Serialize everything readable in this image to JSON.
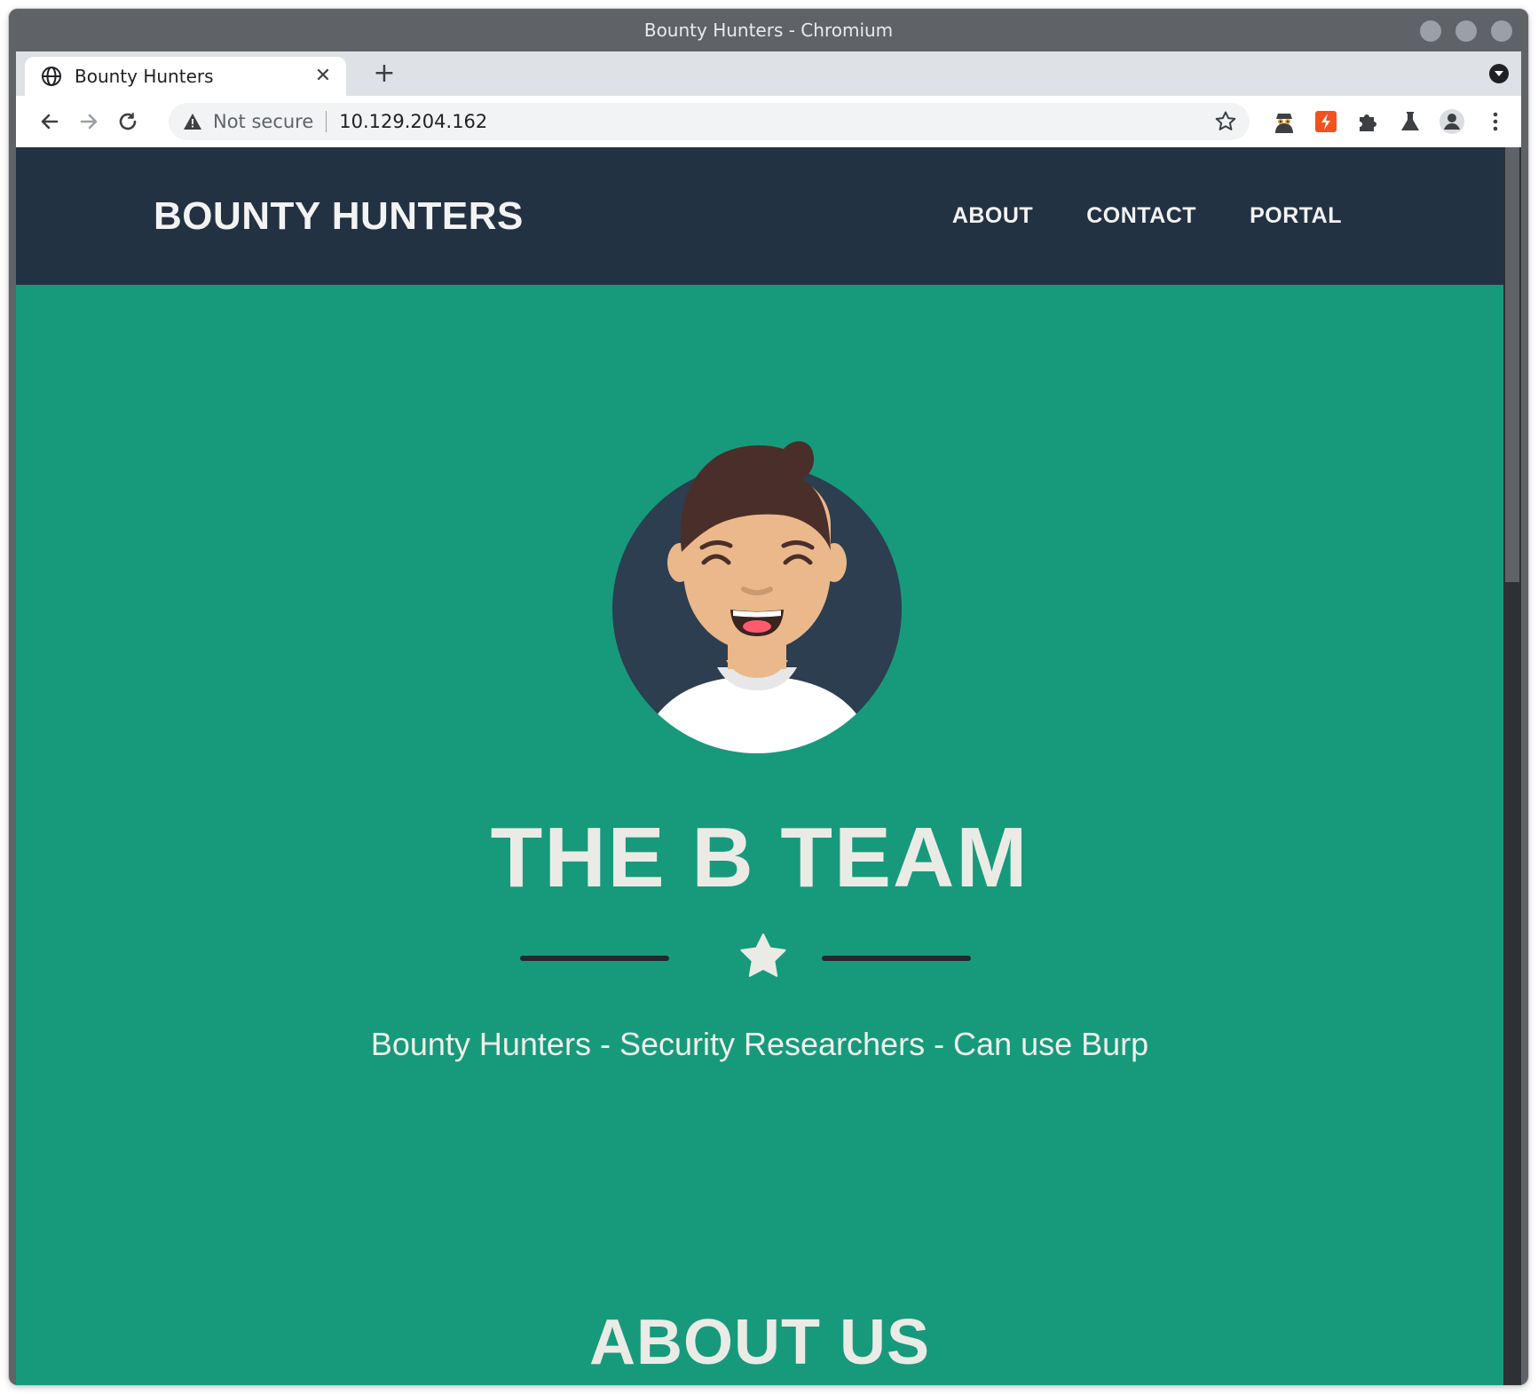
{
  "window": {
    "title": "Bounty Hunters - Chromium"
  },
  "tab": {
    "title": "Bounty Hunters"
  },
  "omnibox": {
    "security_label": "Not secure",
    "url": "10.129.204.162"
  },
  "site": {
    "brand": "BOUNTY HUNTERS",
    "nav": [
      {
        "label": "ABOUT"
      },
      {
        "label": "CONTACT"
      },
      {
        "label": "PORTAL"
      }
    ],
    "hero": {
      "title": "THE B TEAM",
      "tagline": "Bounty Hunters - Security Researchers - Can use Burp"
    },
    "about": {
      "title": "ABOUT US"
    }
  },
  "icons": {
    "tab": "globe-icon",
    "extensions": [
      "spy-extension-icon",
      "flash-extension-icon",
      "puzzle-extensions-icon",
      "flask-labs-icon",
      "profile-avatar-icon",
      "kebab-menu-icon"
    ]
  },
  "colors": {
    "nav_bg": "#233242",
    "hero_bg": "#179a7c",
    "text_light": "#ebebe6",
    "divider": "#1f2a2f"
  }
}
